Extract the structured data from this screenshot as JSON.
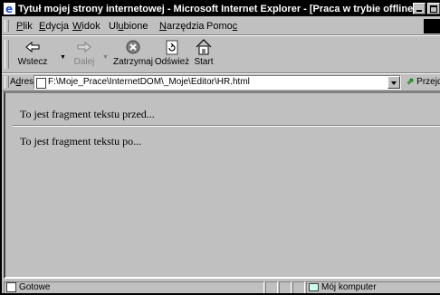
{
  "window": {
    "title": "Tytuł mojej strony internetowej - Microsoft Internet Explorer - [Praca w trybie offline]"
  },
  "menu": [
    {
      "label": "Plik",
      "accel": "P",
      "rest": "lik"
    },
    {
      "label": "Edycja",
      "accel": "E",
      "rest": "dycja"
    },
    {
      "label": "Widok",
      "accel": "W",
      "rest": "idok"
    },
    {
      "label": "Ulubione",
      "pre": "Ul",
      "accel": "u",
      "rest": "bione"
    },
    {
      "label": "Narzędzia",
      "accel": "N",
      "rest": "arzędzia"
    },
    {
      "label": "Pomoc",
      "pre": "Pomo",
      "accel": "c",
      "rest": ""
    }
  ],
  "toolbar": {
    "back": "Wstecz",
    "forward": "Dalej",
    "stop": "Zatrzymaj",
    "refresh": "Odśwież",
    "home": "Start"
  },
  "address": {
    "label_pre": "A",
    "label_accel": "d",
    "label_rest": "res",
    "value": "F:\\Moje_Prace\\InternetDOM\\_Moje\\Editor\\HR.html",
    "go": "Przejdź"
  },
  "content": {
    "before": "To jest fragment tekstu przed...",
    "after": "To jest fragment tekstu po..."
  },
  "status": {
    "text": "Gotowe",
    "zone": "Mój komputer"
  }
}
